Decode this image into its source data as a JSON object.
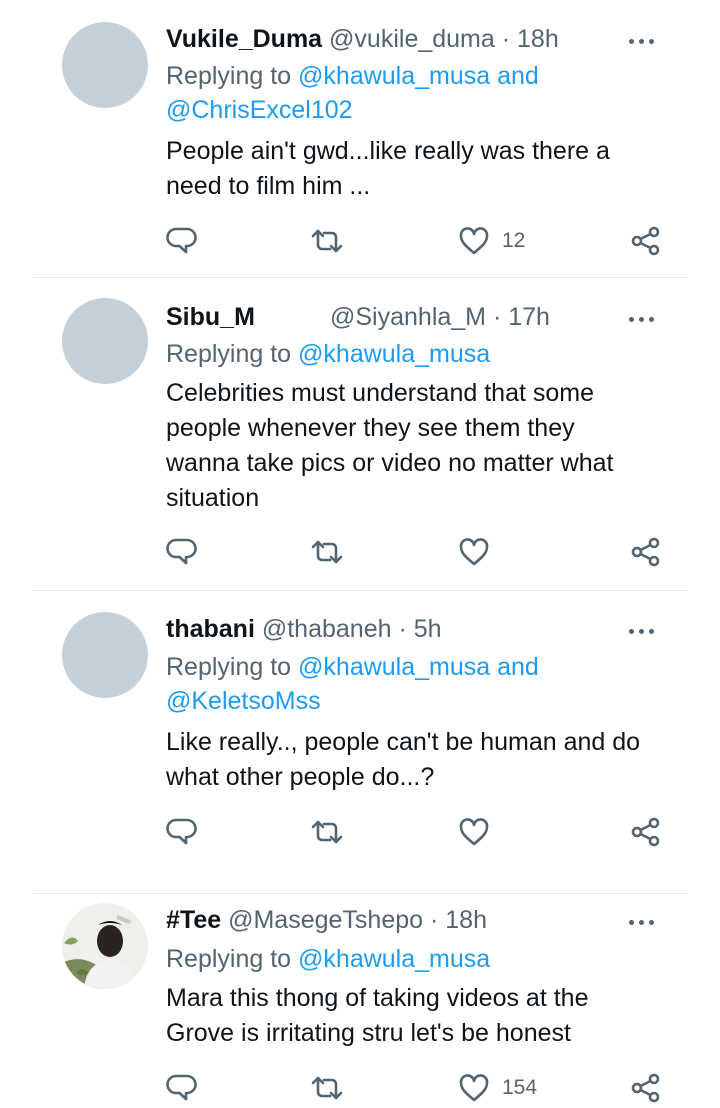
{
  "tweets": [
    {
      "name": "Vukile_Duma",
      "handle": "@vukile_duma",
      "time": "· 18h",
      "reply_prefix": "Replying to",
      "reply_lines": [
        [
          "@khawula_musa",
          " and"
        ],
        [
          "@ChrisExcel102",
          ""
        ]
      ],
      "text_lines": [
        "People ain't gwd...like really was there a",
        "need to film him ..."
      ],
      "likes": "12",
      "avatar": "placeholder"
    },
    {
      "name": "Sibu_M",
      "handle": "@Siyanhla_M",
      "time": "· 17h",
      "reply_prefix": "Replying to",
      "reply_lines": [
        [
          "@khawula_musa",
          ""
        ]
      ],
      "text_lines": [
        "Celebrities must understand that some",
        "people whenever they see them they",
        "wanna take pics or video no matter what",
        "situation"
      ],
      "likes": "",
      "avatar": "placeholder"
    },
    {
      "name": "thabani",
      "handle": "@thabaneh",
      "time": "· 5h",
      "reply_prefix": "Replying to",
      "reply_lines": [
        [
          "@khawula_musa",
          " and"
        ],
        [
          "@KeletsoMss",
          ""
        ]
      ],
      "text_lines": [
        "Like really.., people can't be human and do",
        "what other people do...?"
      ],
      "likes": "",
      "avatar": "placeholder"
    },
    {
      "name": "#Tee",
      "handle": "@MasegeTshepo",
      "time": "· 18h",
      "reply_prefix": "Replying to",
      "reply_lines": [
        [
          "@khawula_musa",
          ""
        ]
      ],
      "text_lines": [
        "Mara this thong of taking videos at the",
        "Grove is irritating stru let's be honest"
      ],
      "likes": "154",
      "avatar": "photo"
    }
  ],
  "icons": {
    "reply": "reply-icon",
    "retweet": "retweet-icon",
    "like": "heart-icon",
    "share": "share-icon",
    "more": "more-icon"
  },
  "colors": {
    "text": "#0f1419",
    "secondary": "#536471",
    "mention": "#1d9bf0",
    "avatar_placeholder": "#c4d0d9",
    "divider": "#e6e9ea"
  }
}
